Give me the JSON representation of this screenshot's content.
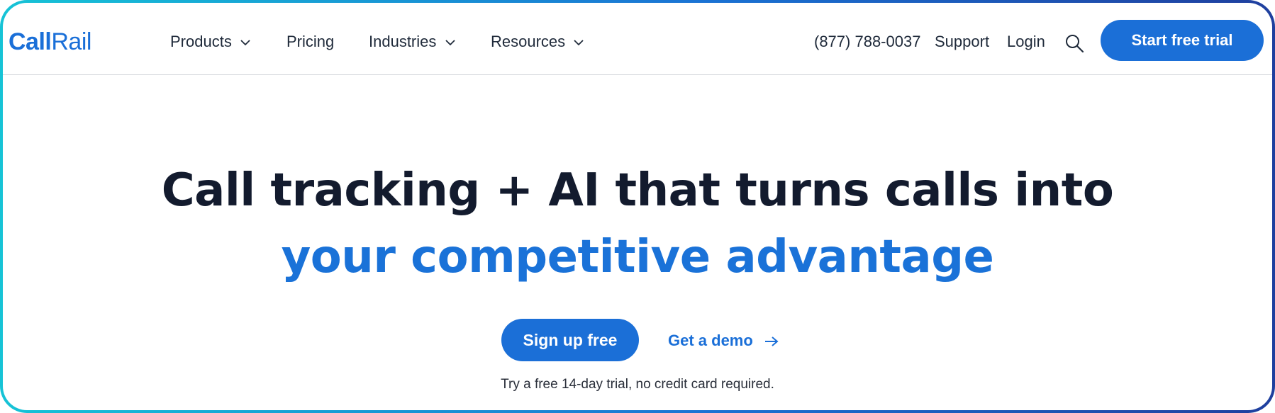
{
  "header": {
    "logo": {
      "part1": "Call",
      "part2": "Rail"
    },
    "nav": [
      {
        "label": "Products",
        "dropdown": true
      },
      {
        "label": "Pricing",
        "dropdown": false
      },
      {
        "label": "Industries",
        "dropdown": true
      },
      {
        "label": "Resources",
        "dropdown": true
      }
    ],
    "phone": "(877) 788-0037",
    "support": "Support",
    "login": "Login",
    "search_icon": "search-icon",
    "cta": "Start free trial"
  },
  "hero": {
    "headline_line1": "Call tracking + AI that turns calls into",
    "headline_line2": "your competitive advantage",
    "primary_button": "Sign up free",
    "secondary_link": "Get a demo",
    "secondary_icon": "arrow-right-icon",
    "note": "Try a free 14-day trial, no credit card required."
  },
  "colors": {
    "brand_blue": "#1b6fd7",
    "headline_dark": "#131b2e",
    "headline_accent": "#1a72d8",
    "frame_gradient_start": "#16c3d6",
    "frame_gradient_end": "#1f3f9e"
  }
}
